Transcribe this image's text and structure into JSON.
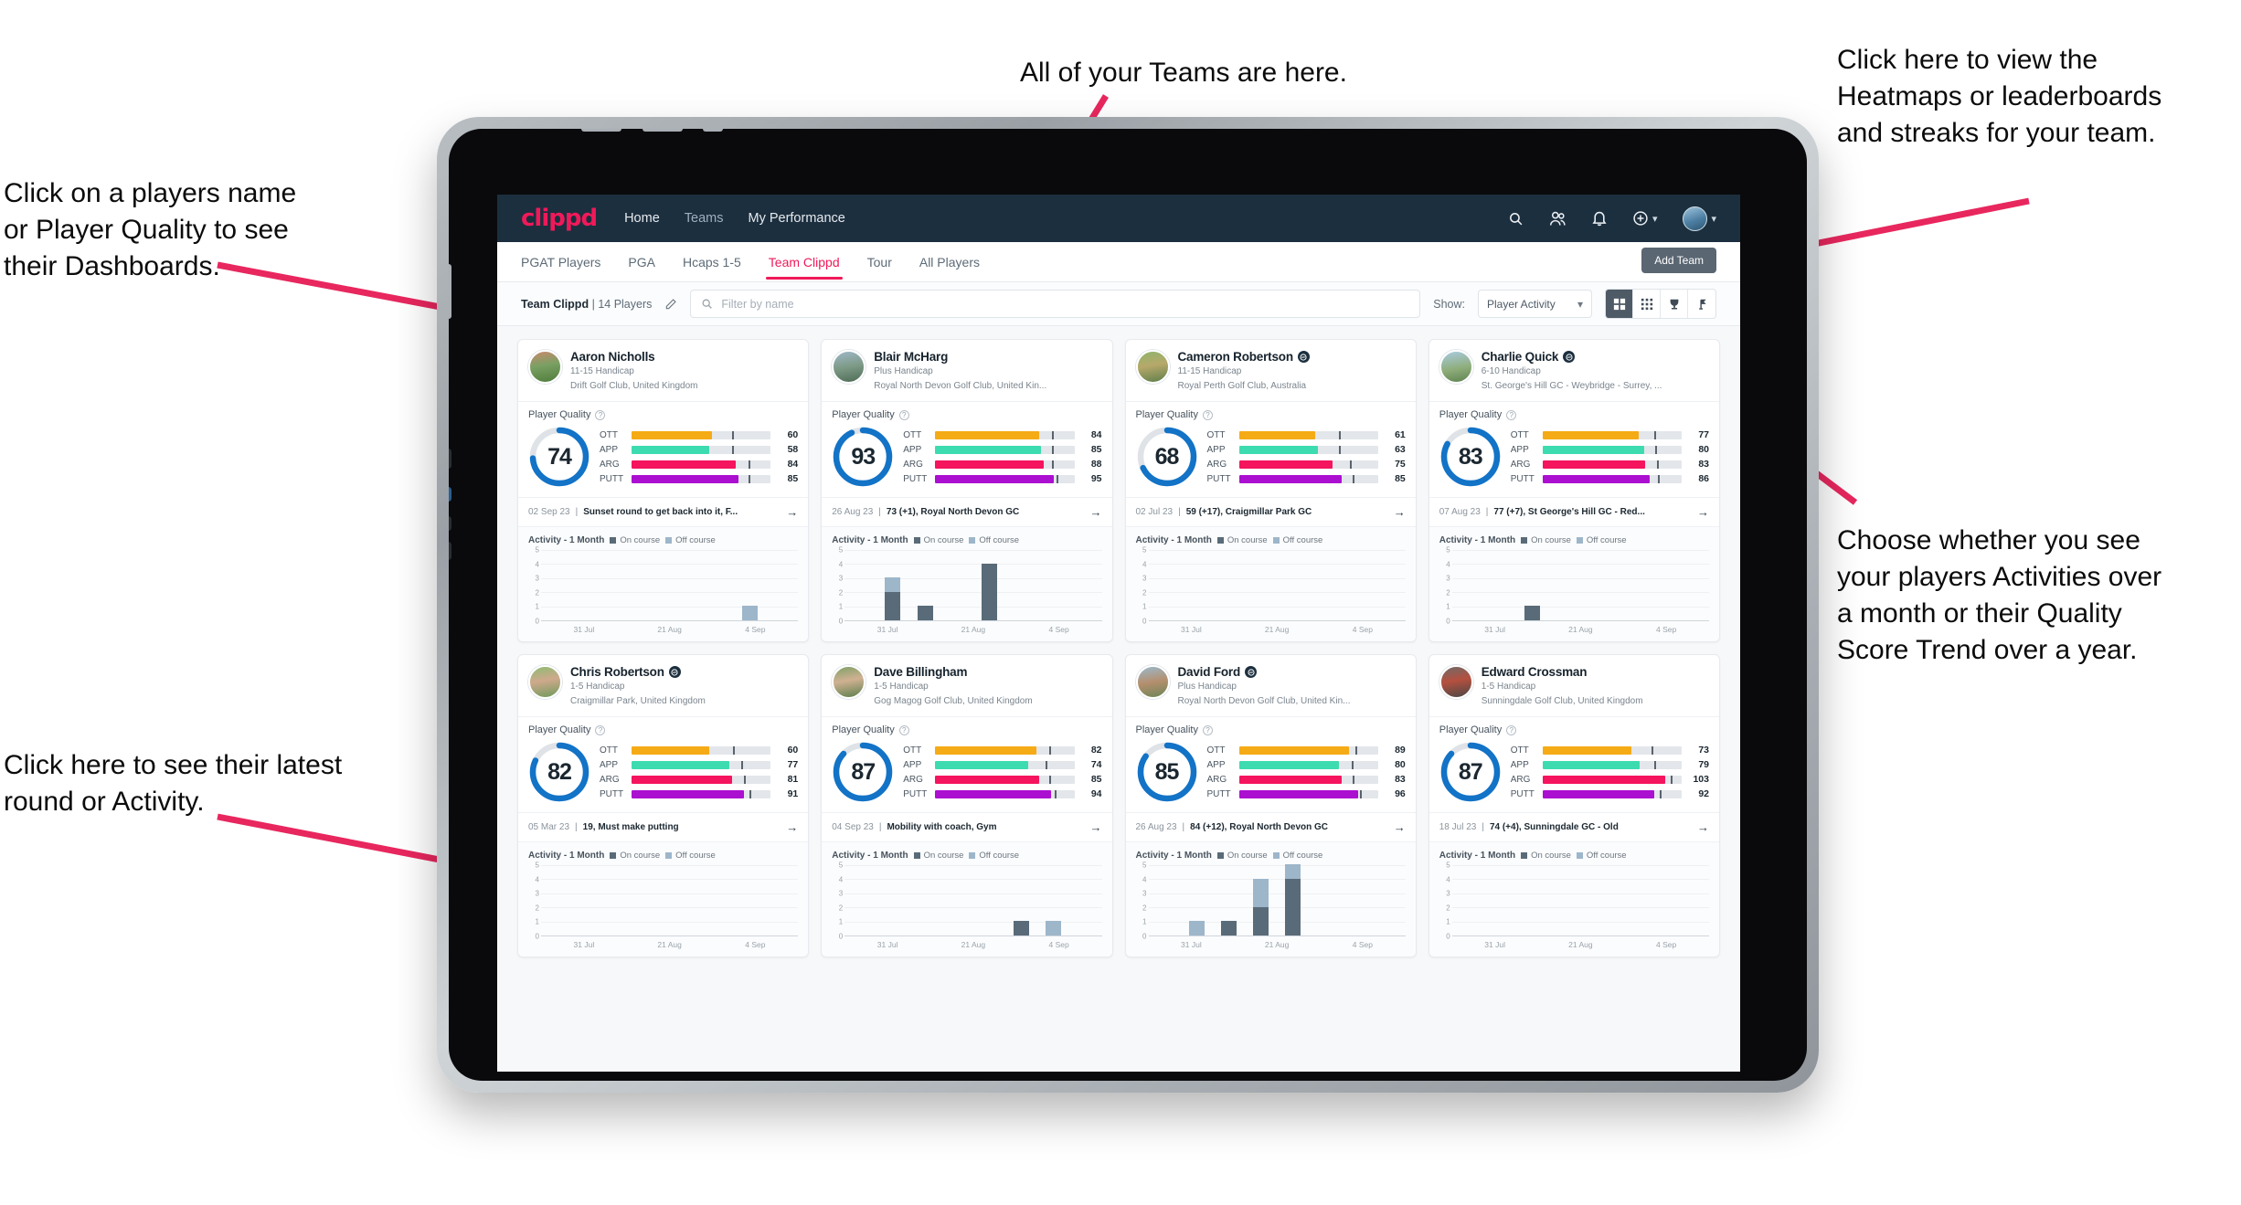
{
  "annotations": [
    {
      "id": "teams",
      "text": "All of your Teams are here."
    },
    {
      "id": "heatmaps",
      "text": "Click here to view the\nHeatmaps or leaderboards\nand streaks for your team."
    },
    {
      "id": "playername",
      "text": "Click on a players name\nor Player Quality to see\ntheir Dashboards."
    },
    {
      "id": "activity-choice",
      "text": "Choose whether you see\nyour players Activities over\na month or their Quality\nScore Trend over a year."
    },
    {
      "id": "latest-round",
      "text": "Click here to see their latest\nround or Activity."
    }
  ],
  "app": {
    "brand": "clippd",
    "nav_links": [
      {
        "label": "Home",
        "active": true
      },
      {
        "label": "Teams",
        "active": false
      },
      {
        "label": "My Performance",
        "active": true
      }
    ],
    "nav_icons": [
      "search-icon",
      "people-icon",
      "bell-icon",
      "plus-circle-icon",
      "avatar"
    ],
    "tabs": [
      {
        "label": "PGAT Players",
        "active": false
      },
      {
        "label": "PGA",
        "active": false
      },
      {
        "label": "Hcaps 1-5",
        "active": false
      },
      {
        "label": "Team Clippd",
        "active": true
      },
      {
        "label": "Tour",
        "active": false
      },
      {
        "label": "All Players",
        "active": false
      }
    ],
    "add_team_label": "Add Team",
    "toolbar": {
      "team_name": "Team Clippd",
      "team_count": "14 Players",
      "separator": "|",
      "edit_icon": "pencil-icon",
      "search_placeholder": "Filter by name",
      "show_label": "Show:",
      "show_value": "Player Activity",
      "view_toggles": [
        {
          "icon": "grid-large-icon",
          "active": true
        },
        {
          "icon": "grid-small-icon",
          "active": false
        },
        {
          "icon": "trophy-icon",
          "active": false
        },
        {
          "icon": "flag-pin-icon",
          "active": false
        }
      ]
    },
    "card_labels": {
      "player_quality": "Player Quality",
      "help_icon": "question-mark-icon",
      "activity_title": "Activity - 1 Month",
      "legend_on": "On course",
      "legend_off": "Off course",
      "arrow_icon": "arrow-right-icon"
    },
    "colors": {
      "brand": "#f0195a",
      "navbar": "#1c2f3f",
      "ring": "#1273c7",
      "ott": "#f5ab16",
      "app": "#3ddbb0",
      "arg": "#f5145e",
      "putt": "#ab0fd0",
      "on_course": "#596b78",
      "off_course": "#9db6ca"
    },
    "chart_axis": {
      "y_ticks": [
        "5",
        "4",
        "3",
        "2",
        "1",
        "0"
      ],
      "x_ticks": [
        "31 Jul",
        "21 Aug",
        "4 Sep"
      ]
    }
  },
  "players": [
    {
      "name": "Aaron Nicholls",
      "verified": false,
      "handicap": "11-15 Handicap",
      "club": "Drift Golf Club, United Kingdom",
      "quality": 74,
      "avatar_css": "linear-gradient(170deg,#c88a6e 0%,#7aa063 45%,#4e7d3c 100%)",
      "metrics": [
        {
          "label": "OTT",
          "value": 60,
          "fill": 58,
          "tick": 72
        },
        {
          "label": "APP",
          "value": 58,
          "fill": 56,
          "tick": 72
        },
        {
          "label": "ARG",
          "value": 84,
          "fill": 75,
          "tick": 84
        },
        {
          "label": "PUTT",
          "value": 85,
          "fill": 77,
          "tick": 84
        }
      ],
      "round_date": "02 Sep 23",
      "round_text": "Sunset round to get back into it, F...",
      "activity": [
        {
          "on": 0,
          "off": 0
        },
        {
          "on": 0,
          "off": 0
        },
        {
          "on": 0,
          "off": 0
        },
        {
          "on": 0,
          "off": 0
        },
        {
          "on": 0,
          "off": 0
        },
        {
          "on": 0,
          "off": 0
        },
        {
          "on": 0,
          "off": 1
        },
        {
          "on": 0,
          "off": 0
        }
      ]
    },
    {
      "name": "Blair McHarg",
      "verified": false,
      "handicap": "Plus Handicap",
      "club": "Royal North Devon Golf Club, United Kin...",
      "quality": 93,
      "avatar_css": "linear-gradient(170deg,#9fb8c9 0%,#7d9a86 50%,#4d6b55 100%)",
      "metrics": [
        {
          "label": "OTT",
          "value": 84,
          "fill": 75,
          "tick": 84
        },
        {
          "label": "APP",
          "value": 85,
          "fill": 76,
          "tick": 84
        },
        {
          "label": "ARG",
          "value": 88,
          "fill": 78,
          "tick": 84
        },
        {
          "label": "PUTT",
          "value": 95,
          "fill": 85,
          "tick": 87
        }
      ],
      "round_date": "26 Aug 23",
      "round_text": "73 (+1), Royal North Devon GC",
      "activity": [
        {
          "on": 0,
          "off": 0
        },
        {
          "on": 2,
          "off": 1
        },
        {
          "on": 1,
          "off": 0
        },
        {
          "on": 0,
          "off": 0
        },
        {
          "on": 4,
          "off": 0
        },
        {
          "on": 0,
          "off": 0
        },
        {
          "on": 0,
          "off": 0
        },
        {
          "on": 0,
          "off": 0
        }
      ]
    },
    {
      "name": "Cameron Robertson",
      "verified": true,
      "handicap": "11-15 Handicap",
      "club": "Royal Perth Golf Club, Australia",
      "quality": 68,
      "avatar_css": "linear-gradient(170deg,#8fb56b 0%,#b7a86a 45%,#5f7f4b 100%)",
      "metrics": [
        {
          "label": "OTT",
          "value": 61,
          "fill": 55,
          "tick": 72
        },
        {
          "label": "APP",
          "value": 63,
          "fill": 57,
          "tick": 72
        },
        {
          "label": "ARG",
          "value": 75,
          "fill": 67,
          "tick": 80
        },
        {
          "label": "PUTT",
          "value": 85,
          "fill": 74,
          "tick": 82
        }
      ],
      "round_date": "02 Jul 23",
      "round_text": "59 (+17), Craigmillar Park GC",
      "activity": [
        {
          "on": 0,
          "off": 0
        },
        {
          "on": 0,
          "off": 0
        },
        {
          "on": 0,
          "off": 0
        },
        {
          "on": 0,
          "off": 0
        },
        {
          "on": 0,
          "off": 0
        },
        {
          "on": 0,
          "off": 0
        },
        {
          "on": 0,
          "off": 0
        },
        {
          "on": 0,
          "off": 0
        }
      ]
    },
    {
      "name": "Charlie Quick",
      "verified": true,
      "handicap": "6-10 Handicap",
      "club": "St. George's Hill GC - Weybridge - Surrey, ...",
      "quality": 83,
      "avatar_css": "linear-gradient(170deg,#a9cbe0 0%,#8fae7c 55%,#5d8350 100%)",
      "metrics": [
        {
          "label": "OTT",
          "value": 77,
          "fill": 69,
          "tick": 80
        },
        {
          "label": "APP",
          "value": 80,
          "fill": 73,
          "tick": 81
        },
        {
          "label": "ARG",
          "value": 83,
          "fill": 74,
          "tick": 82
        },
        {
          "label": "PUTT",
          "value": 86,
          "fill": 77,
          "tick": 83
        }
      ],
      "round_date": "07 Aug 23",
      "round_text": "77 (+7), St George's Hill GC - Red...",
      "activity": [
        {
          "on": 0,
          "off": 0
        },
        {
          "on": 0,
          "off": 0
        },
        {
          "on": 1,
          "off": 0
        },
        {
          "on": 0,
          "off": 0
        },
        {
          "on": 0,
          "off": 0
        },
        {
          "on": 0,
          "off": 0
        },
        {
          "on": 0,
          "off": 0
        },
        {
          "on": 0,
          "off": 0
        }
      ]
    },
    {
      "name": "Chris Robertson",
      "verified": true,
      "handicap": "1-5 Handicap",
      "club": "Craigmillar Park, United Kingdom",
      "quality": 82,
      "avatar_css": "linear-gradient(170deg,#8fbb72 0%,#cfa98c 45%,#6f9a5c 100%)",
      "metrics": [
        {
          "label": "OTT",
          "value": 60,
          "fill": 56,
          "tick": 73
        },
        {
          "label": "APP",
          "value": 77,
          "fill": 70,
          "tick": 79
        },
        {
          "label": "ARG",
          "value": 81,
          "fill": 72,
          "tick": 81
        },
        {
          "label": "PUTT",
          "value": 91,
          "fill": 81,
          "tick": 85
        }
      ],
      "round_date": "05 Mar 23",
      "round_text": "19, Must make putting",
      "activity": [
        {
          "on": 0,
          "off": 0
        },
        {
          "on": 0,
          "off": 0
        },
        {
          "on": 0,
          "off": 0
        },
        {
          "on": 0,
          "off": 0
        },
        {
          "on": 0,
          "off": 0
        },
        {
          "on": 0,
          "off": 0
        },
        {
          "on": 0,
          "off": 0
        },
        {
          "on": 0,
          "off": 0
        }
      ]
    },
    {
      "name": "Dave Billingham",
      "verified": false,
      "handicap": "1-5 Handicap",
      "club": "Gog Magog Golf Club, United Kingdom",
      "quality": 87,
      "avatar_css": "linear-gradient(170deg,#7f9f68 0%,#d0b192 45%,#5d7f4c 100%)",
      "metrics": [
        {
          "label": "OTT",
          "value": 82,
          "fill": 73,
          "tick": 82
        },
        {
          "label": "APP",
          "value": 74,
          "fill": 67,
          "tick": 79
        },
        {
          "label": "ARG",
          "value": 85,
          "fill": 75,
          "tick": 82
        },
        {
          "label": "PUTT",
          "value": 94,
          "fill": 83,
          "tick": 86
        }
      ],
      "round_date": "04 Sep 23",
      "round_text": "Mobility with coach, Gym",
      "activity": [
        {
          "on": 0,
          "off": 0
        },
        {
          "on": 0,
          "off": 0
        },
        {
          "on": 0,
          "off": 0
        },
        {
          "on": 0,
          "off": 0
        },
        {
          "on": 0,
          "off": 0
        },
        {
          "on": 1,
          "off": 0
        },
        {
          "on": 0,
          "off": 1
        },
        {
          "on": 0,
          "off": 0
        }
      ]
    },
    {
      "name": "David Ford",
      "verified": true,
      "handicap": "Plus Handicap",
      "club": "Royal North Devon Golf Club, United Kin...",
      "quality": 85,
      "avatar_css": "linear-gradient(170deg,#9ab9cc 0%,#b58f6e 50%,#6d8457 100%)",
      "metrics": [
        {
          "label": "OTT",
          "value": 89,
          "fill": 79,
          "tick": 84
        },
        {
          "label": "APP",
          "value": 80,
          "fill": 72,
          "tick": 81
        },
        {
          "label": "ARG",
          "value": 83,
          "fill": 74,
          "tick": 82
        },
        {
          "label": "PUTT",
          "value": 96,
          "fill": 86,
          "tick": 87
        }
      ],
      "round_date": "26 Aug 23",
      "round_text": "84 (+12), Royal North Devon GC",
      "activity": [
        {
          "on": 0,
          "off": 0
        },
        {
          "on": 0,
          "off": 1
        },
        {
          "on": 1,
          "off": 0
        },
        {
          "on": 2,
          "off": 2
        },
        {
          "on": 4,
          "off": 1
        },
        {
          "on": 0,
          "off": 0
        },
        {
          "on": 0,
          "off": 0
        },
        {
          "on": 0,
          "off": 0
        }
      ]
    },
    {
      "name": "Edward Crossman",
      "verified": false,
      "handicap": "1-5 Handicap",
      "club": "Sunningdale Golf Club, United Kingdom",
      "quality": 87,
      "avatar_css": "linear-gradient(170deg,#6f6a68 0%,#b5503f 45%,#4a4745 100%)",
      "metrics": [
        {
          "label": "OTT",
          "value": 73,
          "fill": 64,
          "tick": 78
        },
        {
          "label": "APP",
          "value": 79,
          "fill": 70,
          "tick": 80
        },
        {
          "label": "ARG",
          "value": 103,
          "fill": 88,
          "tick": 92
        },
        {
          "label": "PUTT",
          "value": 92,
          "fill": 80,
          "tick": 84
        }
      ],
      "round_date": "18 Jul 23",
      "round_text": "74 (+4), Sunningdale GC - Old",
      "activity": [
        {
          "on": 0,
          "off": 0
        },
        {
          "on": 0,
          "off": 0
        },
        {
          "on": 0,
          "off": 0
        },
        {
          "on": 0,
          "off": 0
        },
        {
          "on": 0,
          "off": 0
        },
        {
          "on": 0,
          "off": 0
        },
        {
          "on": 0,
          "off": 0
        },
        {
          "on": 0,
          "off": 0
        }
      ]
    }
  ]
}
